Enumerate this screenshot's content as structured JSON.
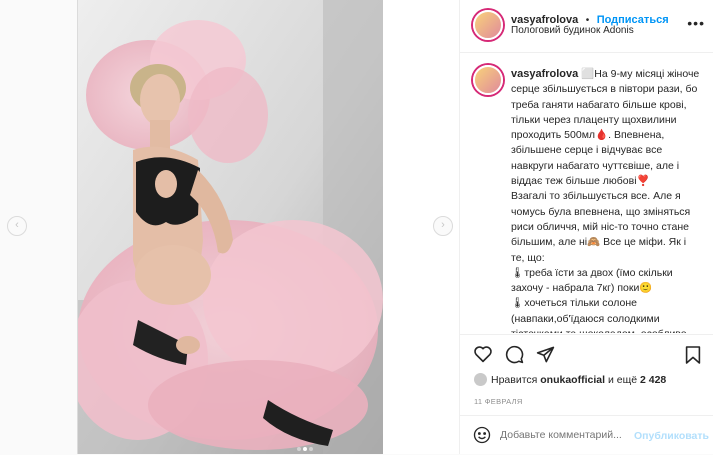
{
  "header": {
    "username": "vasyafrolova",
    "separator": "•",
    "follow_label": "Подписаться",
    "location": "Пологовий будинок Adonis",
    "more_icon": "ellipsis-icon"
  },
  "caption": {
    "username": "vasyafrolova",
    "text": "⬜На 9-му місяці жіноче серце збільшується в півтори рази, бо треба ганяти набагато більше крові, тільки через плаценту щохвилини проходить 500мл🩸. Впевнена, збільшене серце і відчуває все навкруги набагато чуттєвіше, але і віддає теж більше любові❣️\nВзагалі то збільшується все. Але я чомусь була впевнена, що зміняться риси обличчя, мій ніс-то точно стане більшим, але ні🙈 Все це міфи. Як і те, що:\n🌡треба їсти за двох (їмо скільки захочу - набрала 7кг) поки🙂\n🌡хочеться тільки солоне (навпаки,об'їдаюся солодкими тістечками та шоколадом, особливо на ніч), але потім можна її"
  },
  "actions": {
    "like_icon": "heart-icon",
    "comment_icon": "comment-icon",
    "share_icon": "share-icon",
    "save_icon": "bookmark-icon"
  },
  "likes": {
    "prefix": "Нравится",
    "liked_by": "onukaofficial",
    "middle": "и ещё",
    "count": "2 428"
  },
  "date": "11 ФЕВРАЛЯ",
  "comment": {
    "emoji_icon": "smiley-icon",
    "placeholder": "Добавьте комментарий...",
    "publish_label": "Опубликовать"
  },
  "carousel": {
    "prev_icon": "chevron-left-icon",
    "next_icon": "chevron-right-icon",
    "slide_count": 3,
    "active_slide": 2
  },
  "colors": {
    "accent": "#0095f6",
    "publish_disabled": "#b2dffc",
    "dress": "#f2c4cf",
    "background": "#fafafa"
  }
}
